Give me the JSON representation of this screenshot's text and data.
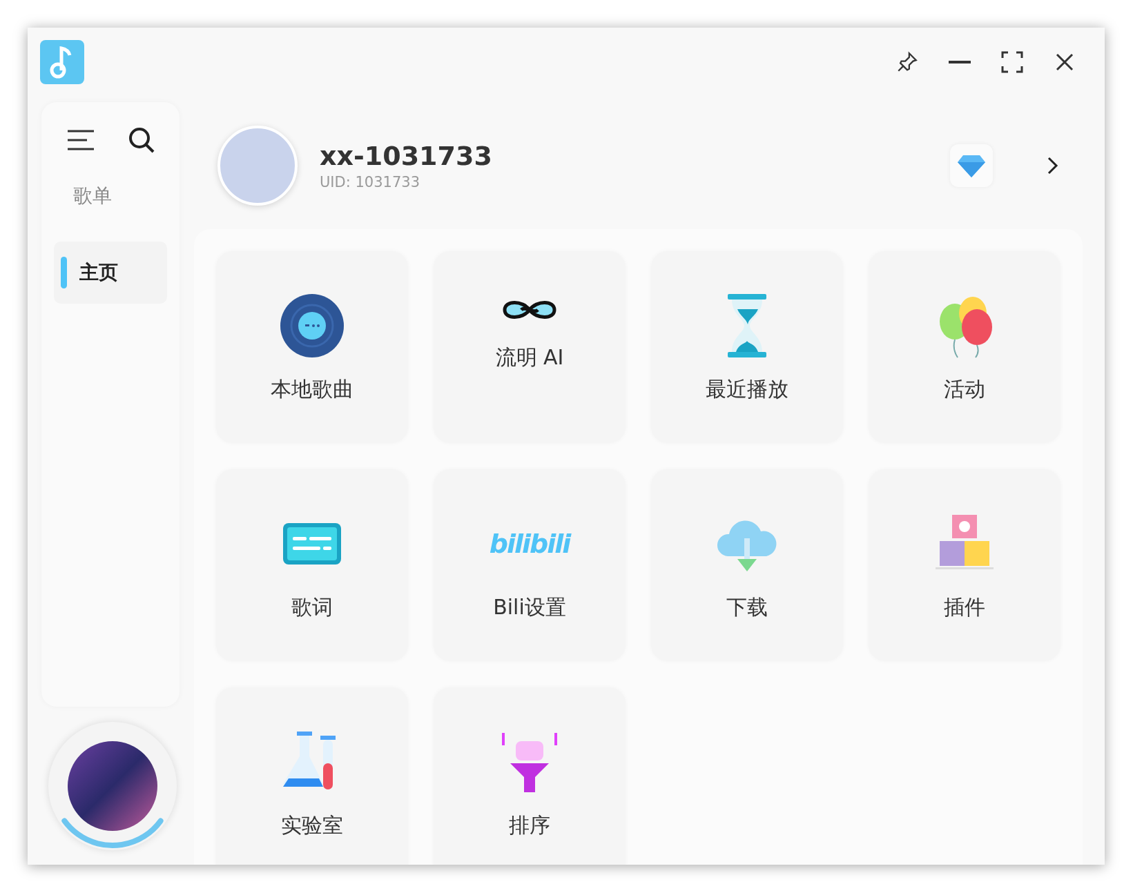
{
  "sidebar": {
    "items": [
      {
        "label": "歌单",
        "selected": false
      },
      {
        "label": "主页",
        "selected": true
      }
    ]
  },
  "profile": {
    "name": "xx-1031733",
    "uid": "UID: 1031733"
  },
  "player": {
    "level": 0.3
  },
  "tiles": [
    {
      "kind": "disc",
      "label": "本地歌曲"
    },
    {
      "kind": "infinity",
      "label": "流明 AI"
    },
    {
      "kind": "hourglass",
      "label": "最近播放"
    },
    {
      "kind": "balloons",
      "label": "活动"
    },
    {
      "kind": "lyrics",
      "label": "歌词"
    },
    {
      "kind": "bili",
      "label": "Bili设置",
      "icon_text": "bilibili"
    },
    {
      "kind": "download",
      "label": "下载"
    },
    {
      "kind": "plugin",
      "label": "插件"
    },
    {
      "kind": "lab",
      "label": "实验室"
    },
    {
      "kind": "sort",
      "label": "排序"
    }
  ]
}
